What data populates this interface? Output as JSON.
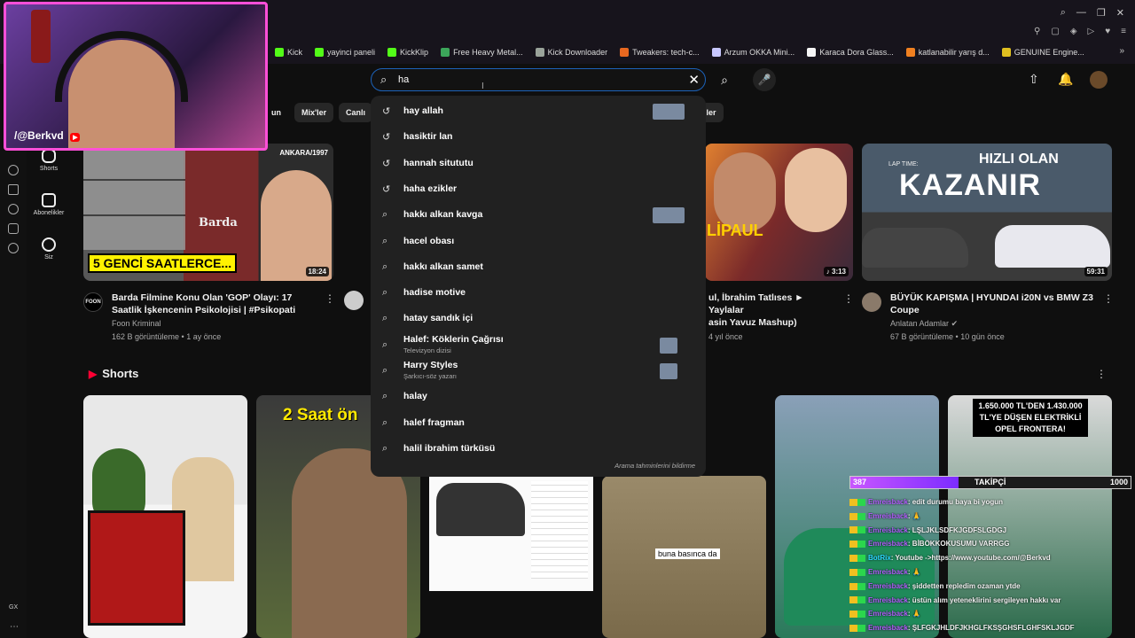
{
  "browser": {
    "bookmarks": [
      {
        "label": "Kick",
        "color": "#53fc18"
      },
      {
        "label": "yayinci paneli",
        "color": "#53fc18"
      },
      {
        "label": "KickKlip",
        "color": "#53fc18"
      },
      {
        "label": "Free Heavy Metal...",
        "color": "#3ca65a"
      },
      {
        "label": "Kick Downloader",
        "color": "#9aa39a"
      },
      {
        "label": "Tweakers: tech-c...",
        "color": "#e86820"
      },
      {
        "label": "Arzum OKKA Mini...",
        "color": "#c8c8ff"
      },
      {
        "label": "Karaca Dora Glass...",
        "color": "#f5f5f5"
      },
      {
        "label": "katlanabilir yarış d...",
        "color": "#f08020"
      },
      {
        "label": "GENUINE Engine...",
        "color": "#e0c020"
      }
    ]
  },
  "sidebar": {
    "items": [
      {
        "label": "Shorts"
      },
      {
        "label": "Abonelikler"
      },
      {
        "label": "Siz"
      }
    ],
    "gx_label": "GX"
  },
  "header": {
    "search_value": "ha",
    "chips": [
      "un",
      "Mix'ler",
      "Canlı",
      "iler"
    ]
  },
  "suggestions": {
    "items": [
      {
        "text": "hay allah",
        "type": "history"
      },
      {
        "text": "hasiktir lan",
        "type": "history"
      },
      {
        "text": "hannah sitututu",
        "type": "history"
      },
      {
        "text": "haha ezikler",
        "type": "history"
      },
      {
        "text": "hakkı alkan kavga",
        "type": "search"
      },
      {
        "text": "hacel obası",
        "type": "search"
      },
      {
        "text": "hakkı alkan samet",
        "type": "search"
      },
      {
        "text": "hadise motive",
        "type": "search"
      },
      {
        "text": "hatay sandık içi",
        "type": "search"
      },
      {
        "text": "Halef: Köklerin Çağrısı",
        "sub": "Televizyon dizisi",
        "type": "search"
      },
      {
        "text": "Harry Styles",
        "sub": "Şarkıcı-söz yazarı",
        "type": "search"
      },
      {
        "text": "halay",
        "type": "search"
      },
      {
        "text": "halef fragman",
        "type": "search"
      },
      {
        "text": "halil ibrahim türküsü",
        "type": "search"
      }
    ],
    "footer": "Arama tahminlerini bildirme"
  },
  "videos": [
    {
      "thumb_text": "5 GENCİ SAATLERCE...",
      "thumb_badge": "ANKARA/1997",
      "thumb_logo": "Barda",
      "duration": "18:24",
      "title": "Barda Filmine Konu Olan 'GOP' Olayı: 17 Saatlik İşkencenin Psikolojisi | #Psikopati",
      "channel": "Foon Kriminal",
      "meta": "162 B görüntüleme • 1 ay önce",
      "channel_avatar": "FOON"
    },
    {
      "thumb_text": "LİPAUL",
      "duration": "♪ 3:13",
      "title": "ul, İbrahim Tatlıses ► Yaylalar\nasin Yavuz Mashup)",
      "meta": "4 yıl önce"
    },
    {
      "thumb_text_1": "HIZLI OLAN",
      "thumb_text_2": "KAZANIR",
      "thumb_badge": "LAP TIME:",
      "duration": "59:31",
      "title": "BÜYÜK KAPIŞMA | HYUNDAI i20N vs BMW Z3 Coupe",
      "channel": "Anlatan Adamlar",
      "meta": "67 B görüntüleme • 10 gün önce"
    }
  ],
  "shorts": {
    "heading": "Shorts",
    "thumb_texts": [
      "2 Saat ön",
      "buna basınca da",
      "1.650.000 TL'DEN 1.430.000 TL'YE DÜŞEN ELEKTRİKLİ OPEL FRONTERA!"
    ]
  },
  "stream_overlay": {
    "webcam_user": "/@Berkvd",
    "follow_current": "387",
    "follow_label": "TAKİPÇİ",
    "follow_goal": "1000",
    "follow_fraction": 0.387,
    "chat": [
      {
        "user": "Emreisback",
        "msg": ": edit durumu baya bi yogun"
      },
      {
        "user": "Emreisback",
        "msg": ": 🙏"
      },
      {
        "user": "Emreisback",
        "msg": ": LŞLJKLSDFKJGDFSLGDGJ"
      },
      {
        "user": "Emreisback",
        "msg": ": BİBÖKKOKUSUMU VARRGG"
      },
      {
        "user": "BotRix",
        "msg": ": Youtube ->https://www.youtube.com/@Berkvd",
        "bot": true
      },
      {
        "user": "Emreisback",
        "msg": ": 🙏"
      },
      {
        "user": "Emreisback",
        "msg": ": şiddetten repledim ozaman ytde"
      },
      {
        "user": "Emreisback",
        "msg": ": üstün alım yeteneklirini sergileyen hakkı var"
      },
      {
        "user": "Emreisback",
        "msg": ": 🙏"
      },
      {
        "user": "Emreisback",
        "msg": ": ŞLFGKJHLDFJKHGLFKSŞGHSFLGHFSKLJGDF"
      }
    ]
  }
}
